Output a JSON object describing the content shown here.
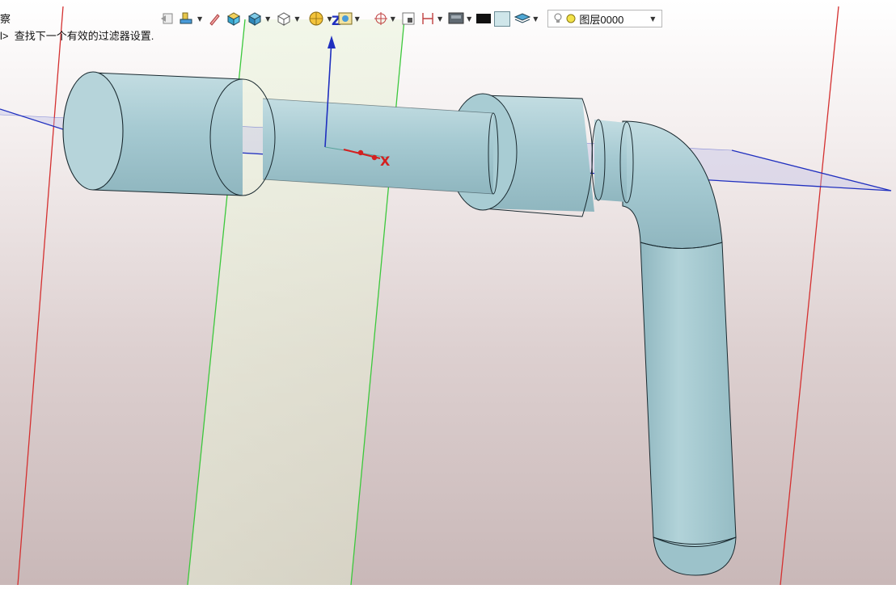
{
  "toolbar": {
    "icons": [
      "undo-icon",
      "render-style-icon",
      "pencil-icon",
      "shaded-box-icon",
      "solid-cube-icon",
      "wireframe-cube-icon",
      "orient-view-icon",
      "image-icon",
      "snap-target-icon",
      "frame-icon",
      "dimension-icon",
      "display-icon",
      "black-color-chip",
      "color-box-icon",
      "layers-icon"
    ],
    "layer_label": "图层0000"
  },
  "status": {
    "top_fragment": "察",
    "prefix": "l>",
    "message": "查找下一个有效的过滤器设置."
  },
  "viewport": {
    "axis_z_label": "Z",
    "axis_x_label": "X",
    "colors": {
      "part_fill": "#a9ccd3",
      "part_edge": "#1a2a30",
      "datum_plane_blue": "#1f2fbf",
      "datum_plane_green": "#3cc83c",
      "datum_plane_red": "#d43030"
    }
  }
}
